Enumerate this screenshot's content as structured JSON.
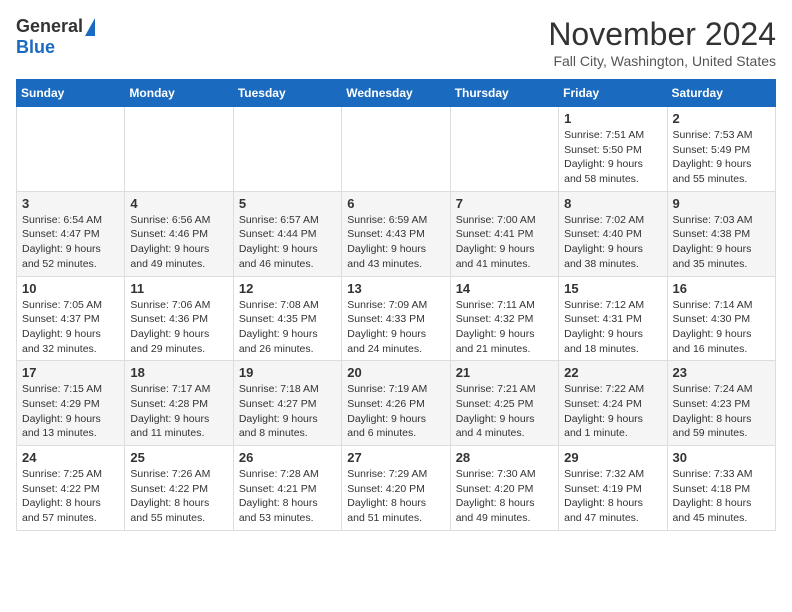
{
  "header": {
    "logo_general": "General",
    "logo_blue": "Blue",
    "month_title": "November 2024",
    "location": "Fall City, Washington, United States"
  },
  "weekdays": [
    "Sunday",
    "Monday",
    "Tuesday",
    "Wednesday",
    "Thursday",
    "Friday",
    "Saturday"
  ],
  "weeks": [
    [
      {
        "day": "",
        "info": ""
      },
      {
        "day": "",
        "info": ""
      },
      {
        "day": "",
        "info": ""
      },
      {
        "day": "",
        "info": ""
      },
      {
        "day": "",
        "info": ""
      },
      {
        "day": "1",
        "info": "Sunrise: 7:51 AM\nSunset: 5:50 PM\nDaylight: 9 hours and 58 minutes."
      },
      {
        "day": "2",
        "info": "Sunrise: 7:53 AM\nSunset: 5:49 PM\nDaylight: 9 hours and 55 minutes."
      }
    ],
    [
      {
        "day": "3",
        "info": "Sunrise: 6:54 AM\nSunset: 4:47 PM\nDaylight: 9 hours and 52 minutes."
      },
      {
        "day": "4",
        "info": "Sunrise: 6:56 AM\nSunset: 4:46 PM\nDaylight: 9 hours and 49 minutes."
      },
      {
        "day": "5",
        "info": "Sunrise: 6:57 AM\nSunset: 4:44 PM\nDaylight: 9 hours and 46 minutes."
      },
      {
        "day": "6",
        "info": "Sunrise: 6:59 AM\nSunset: 4:43 PM\nDaylight: 9 hours and 43 minutes."
      },
      {
        "day": "7",
        "info": "Sunrise: 7:00 AM\nSunset: 4:41 PM\nDaylight: 9 hours and 41 minutes."
      },
      {
        "day": "8",
        "info": "Sunrise: 7:02 AM\nSunset: 4:40 PM\nDaylight: 9 hours and 38 minutes."
      },
      {
        "day": "9",
        "info": "Sunrise: 7:03 AM\nSunset: 4:38 PM\nDaylight: 9 hours and 35 minutes."
      }
    ],
    [
      {
        "day": "10",
        "info": "Sunrise: 7:05 AM\nSunset: 4:37 PM\nDaylight: 9 hours and 32 minutes."
      },
      {
        "day": "11",
        "info": "Sunrise: 7:06 AM\nSunset: 4:36 PM\nDaylight: 9 hours and 29 minutes."
      },
      {
        "day": "12",
        "info": "Sunrise: 7:08 AM\nSunset: 4:35 PM\nDaylight: 9 hours and 26 minutes."
      },
      {
        "day": "13",
        "info": "Sunrise: 7:09 AM\nSunset: 4:33 PM\nDaylight: 9 hours and 24 minutes."
      },
      {
        "day": "14",
        "info": "Sunrise: 7:11 AM\nSunset: 4:32 PM\nDaylight: 9 hours and 21 minutes."
      },
      {
        "day": "15",
        "info": "Sunrise: 7:12 AM\nSunset: 4:31 PM\nDaylight: 9 hours and 18 minutes."
      },
      {
        "day": "16",
        "info": "Sunrise: 7:14 AM\nSunset: 4:30 PM\nDaylight: 9 hours and 16 minutes."
      }
    ],
    [
      {
        "day": "17",
        "info": "Sunrise: 7:15 AM\nSunset: 4:29 PM\nDaylight: 9 hours and 13 minutes."
      },
      {
        "day": "18",
        "info": "Sunrise: 7:17 AM\nSunset: 4:28 PM\nDaylight: 9 hours and 11 minutes."
      },
      {
        "day": "19",
        "info": "Sunrise: 7:18 AM\nSunset: 4:27 PM\nDaylight: 9 hours and 8 minutes."
      },
      {
        "day": "20",
        "info": "Sunrise: 7:19 AM\nSunset: 4:26 PM\nDaylight: 9 hours and 6 minutes."
      },
      {
        "day": "21",
        "info": "Sunrise: 7:21 AM\nSunset: 4:25 PM\nDaylight: 9 hours and 4 minutes."
      },
      {
        "day": "22",
        "info": "Sunrise: 7:22 AM\nSunset: 4:24 PM\nDaylight: 9 hours and 1 minute."
      },
      {
        "day": "23",
        "info": "Sunrise: 7:24 AM\nSunset: 4:23 PM\nDaylight: 8 hours and 59 minutes."
      }
    ],
    [
      {
        "day": "24",
        "info": "Sunrise: 7:25 AM\nSunset: 4:22 PM\nDaylight: 8 hours and 57 minutes."
      },
      {
        "day": "25",
        "info": "Sunrise: 7:26 AM\nSunset: 4:22 PM\nDaylight: 8 hours and 55 minutes."
      },
      {
        "day": "26",
        "info": "Sunrise: 7:28 AM\nSunset: 4:21 PM\nDaylight: 8 hours and 53 minutes."
      },
      {
        "day": "27",
        "info": "Sunrise: 7:29 AM\nSunset: 4:20 PM\nDaylight: 8 hours and 51 minutes."
      },
      {
        "day": "28",
        "info": "Sunrise: 7:30 AM\nSunset: 4:20 PM\nDaylight: 8 hours and 49 minutes."
      },
      {
        "day": "29",
        "info": "Sunrise: 7:32 AM\nSunset: 4:19 PM\nDaylight: 8 hours and 47 minutes."
      },
      {
        "day": "30",
        "info": "Sunrise: 7:33 AM\nSunset: 4:18 PM\nDaylight: 8 hours and 45 minutes."
      }
    ]
  ]
}
